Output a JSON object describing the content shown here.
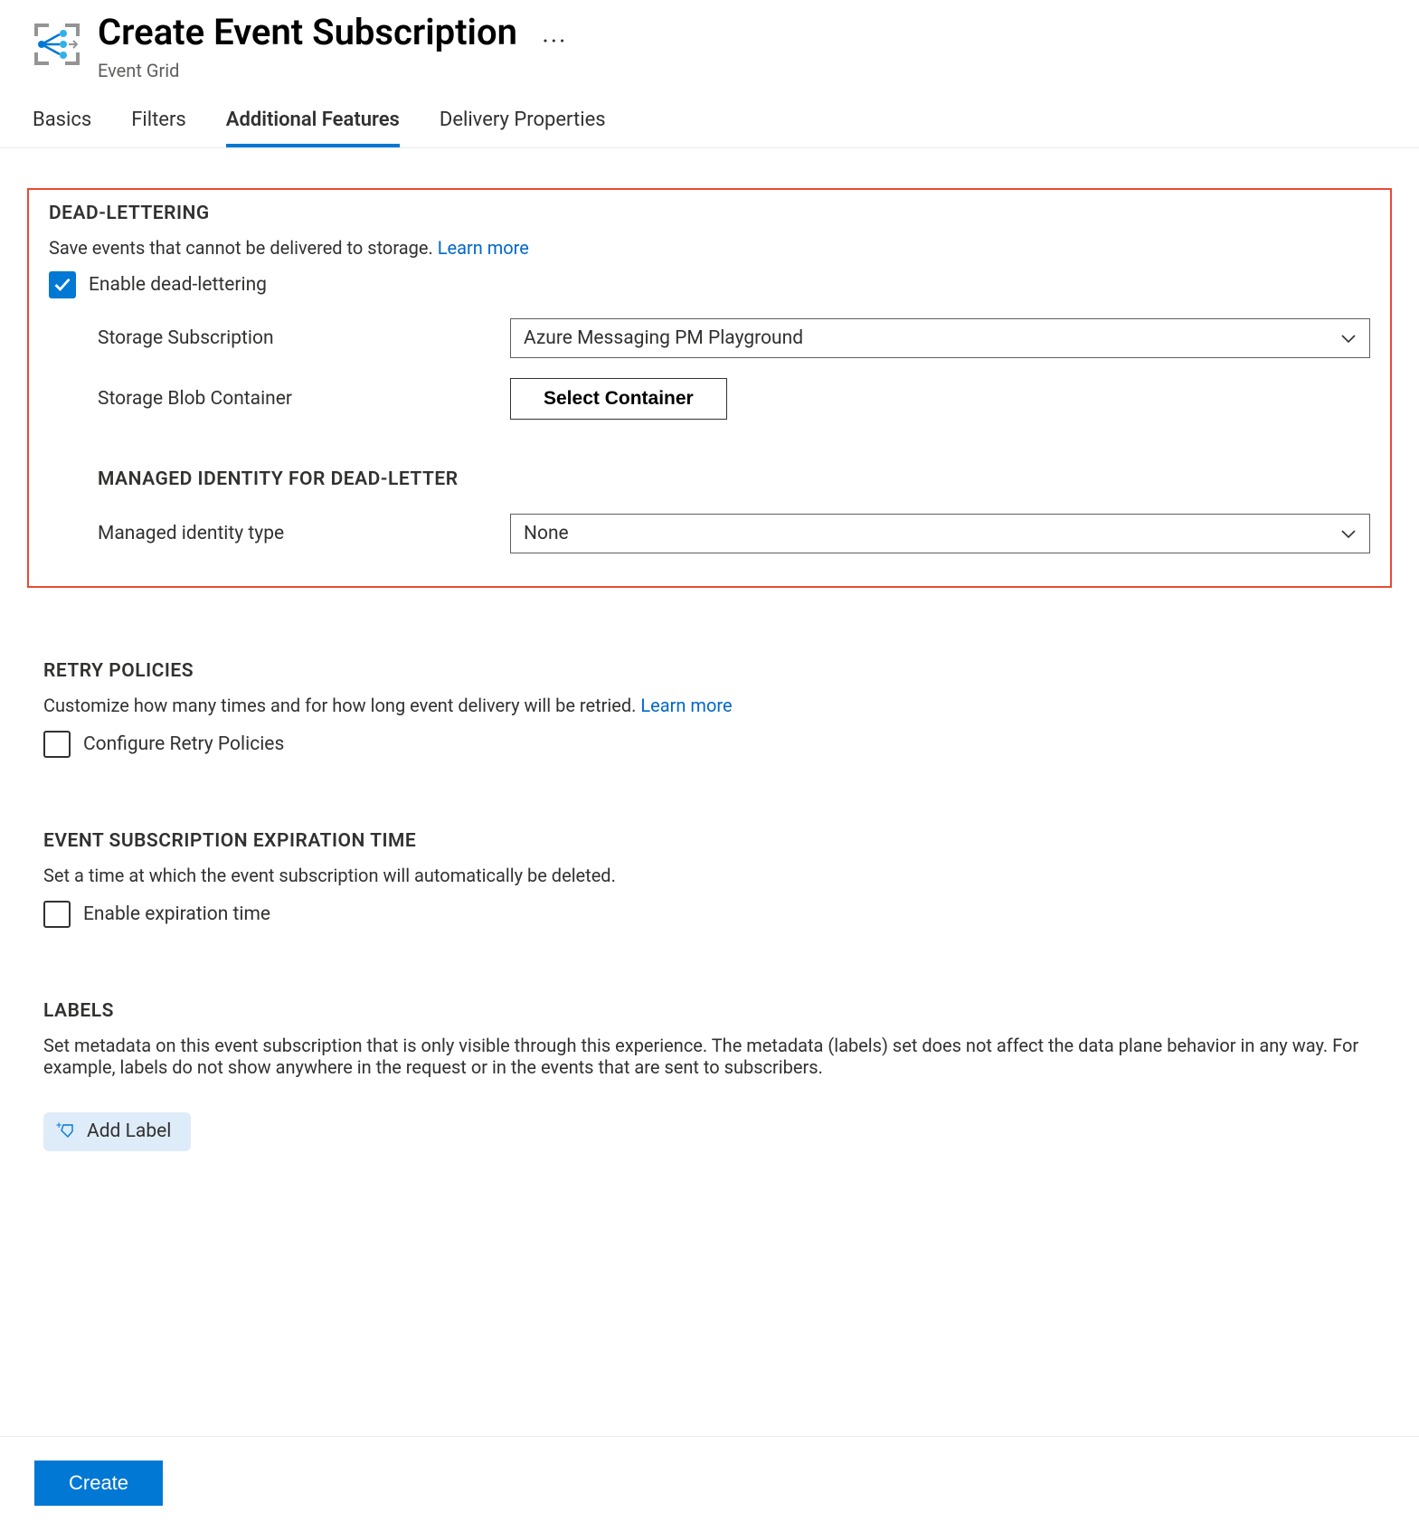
{
  "header": {
    "title": "Create Event Subscription",
    "subtitle": "Event Grid"
  },
  "tabs": [
    {
      "label": "Basics",
      "active": false
    },
    {
      "label": "Filters",
      "active": false
    },
    {
      "label": "Additional Features",
      "active": true
    },
    {
      "label": "Delivery Properties",
      "active": false
    }
  ],
  "deadLettering": {
    "heading": "DEAD-LETTERING",
    "description": "Save events that cannot be delivered to storage. ",
    "learnMore": "Learn more",
    "enableLabel": "Enable dead-lettering",
    "enabled": true,
    "storageSubscriptionLabel": "Storage Subscription",
    "storageSubscriptionValue": "Azure Messaging PM Playground",
    "blobContainerLabel": "Storage Blob Container",
    "selectContainerButton": "Select Container",
    "managedIdentityHeading": "MANAGED IDENTITY FOR DEAD-LETTER",
    "managedIdentityLabel": "Managed identity type",
    "managedIdentityValue": "None"
  },
  "retry": {
    "heading": "RETRY POLICIES",
    "description": "Customize how many times and for how long event delivery will be retried. ",
    "learnMore": "Learn more",
    "configureLabel": "Configure Retry Policies",
    "enabled": false
  },
  "expiration": {
    "heading": "EVENT SUBSCRIPTION EXPIRATION TIME",
    "description": "Set a time at which the event subscription will automatically be deleted.",
    "enableLabel": "Enable expiration time",
    "enabled": false
  },
  "labels": {
    "heading": "LABELS",
    "description": "Set metadata on this event subscription that is only visible through this experience. The metadata (labels) set does not affect the data plane behavior in any way. For example, labels do not show anywhere in the request or in the events that are sent to subscribers.",
    "addLabelButton": "Add Label"
  },
  "footer": {
    "createButton": "Create"
  }
}
